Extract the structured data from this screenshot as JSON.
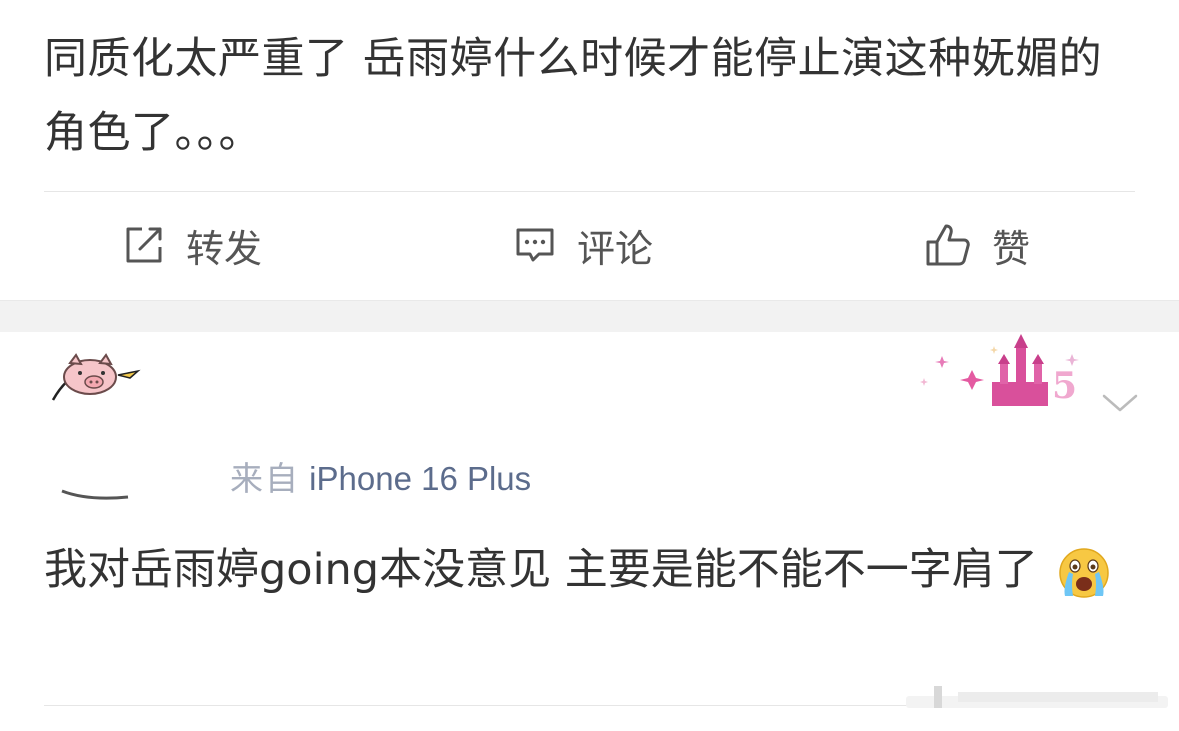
{
  "post": {
    "text": "同质化太严重了 岳雨婷什么时候才能停止演这种妩媚的角色了。。。"
  },
  "actions": {
    "repost_label": "转发",
    "comment_label": "评论",
    "like_label": "赞"
  },
  "comment": {
    "source_prefix": "来自",
    "device": "iPhone 16 Plus",
    "text": "我对岳雨婷going本没意见 主要是能不能不一字肩了",
    "emoji": "crying-face-emoji"
  },
  "colors": {
    "text_primary": "#333333",
    "action_label": "#555555",
    "meta_blue": "#5c6c8c",
    "section_gap": "#f2f2f2",
    "divider": "#e6e6e6",
    "badge_pink": "#e0609a"
  }
}
